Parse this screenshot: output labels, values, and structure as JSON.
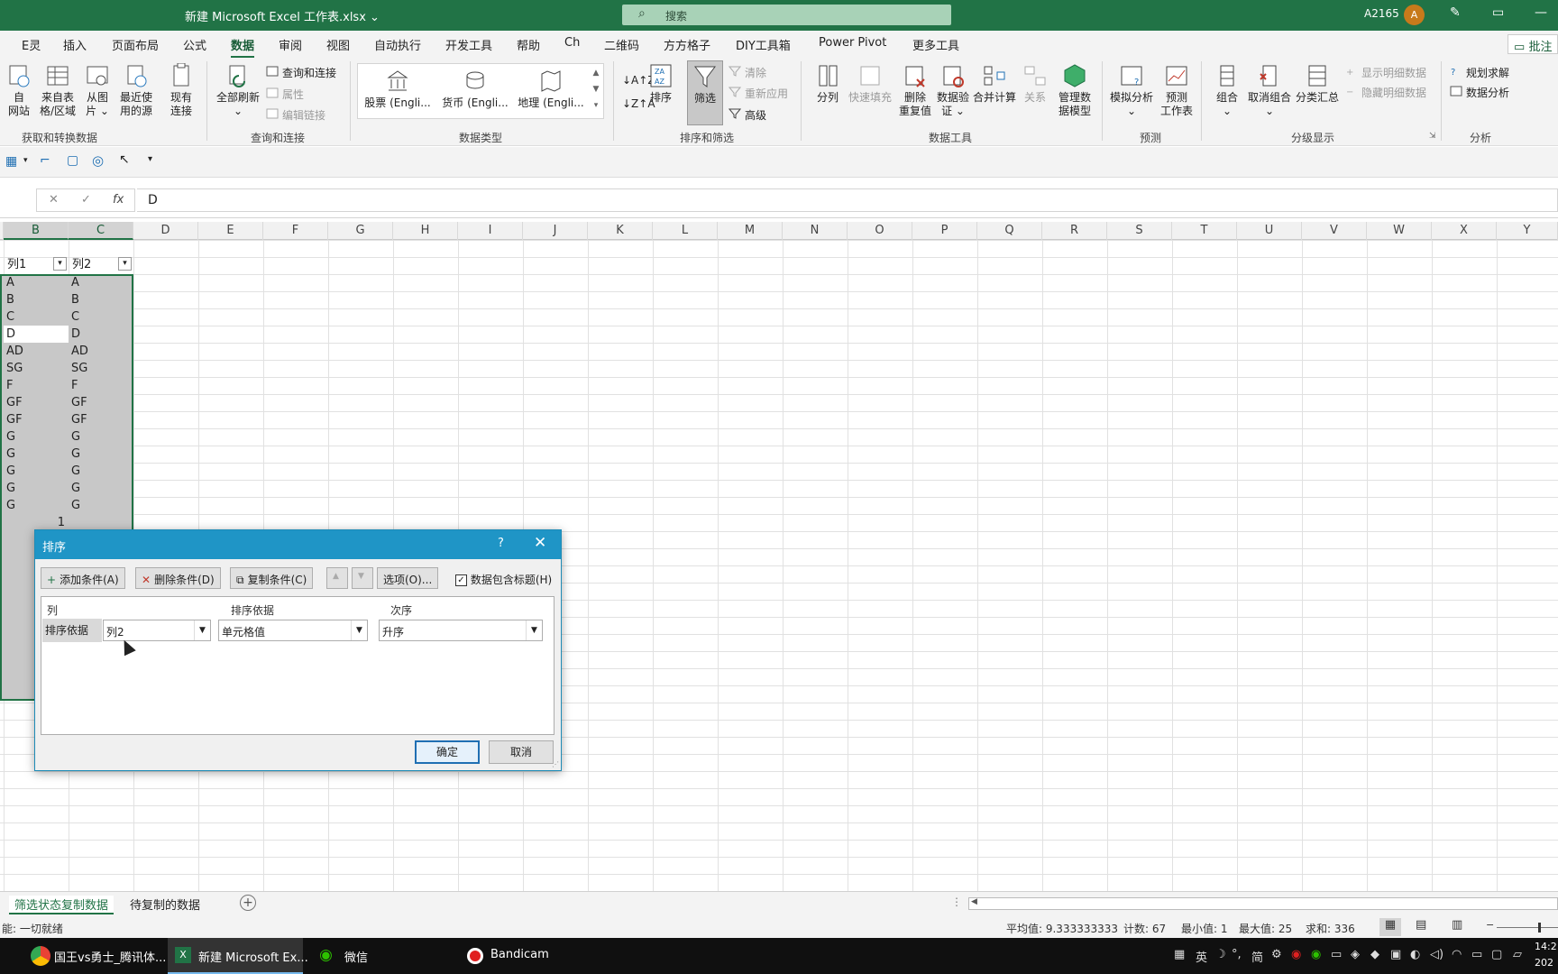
{
  "titlebar": {
    "file_title": "新建 Microsoft Excel 工作表.xlsx ⌄",
    "search_placeholder": "搜索",
    "user_name": "A2165",
    "avatar_initial": "A"
  },
  "tabs": [
    "E灵",
    "插入",
    "页面布局",
    "公式",
    "数据",
    "审阅",
    "视图",
    "自动执行",
    "开发工具",
    "帮助",
    "Ch",
    "二维码",
    "方方格子",
    "DIY工具箱",
    "Power Pivot",
    "更多工具"
  ],
  "active_tab": "数据",
  "comment_label": "批注",
  "ribbon": {
    "get_data": {
      "from_web": "自\n网站",
      "from_table": "来自表\n格/区域",
      "from_picture": "从图\n片 ⌄",
      "recent_sources": "最近使\n用的源",
      "existing_connections": "现有\n连接",
      "group_label": "获取和转换数据"
    },
    "queries": {
      "refresh_all": "全部刷新",
      "queries_connections": "查询和连接",
      "properties": "属性",
      "edit_links": "编辑链接",
      "group_label": "查询和连接"
    },
    "data_types": {
      "stocks": "股票 (Engli...",
      "currency": "货币 (Engli...",
      "geography": "地理 (Engli...",
      "group_label": "数据类型"
    },
    "sort_filter": {
      "sort": "排序",
      "filter": "筛选",
      "clear": "清除",
      "reapply": "重新应用",
      "advanced": "高级",
      "group_label": "排序和筛选"
    },
    "data_tools": {
      "text_to_columns": "分列",
      "flash_fill": "快速填充",
      "remove_duplicates": "删除\n重复值",
      "data_validation": "数据验\n证 ⌄",
      "consolidate": "合并计算",
      "relationships": "关系",
      "manage_model": "管理数\n据模型",
      "group_label": "数据工具"
    },
    "forecast": {
      "what_if": "模拟分析\n⌄",
      "forecast_sheet": "预测\n工作表",
      "group_label": "预测"
    },
    "outline": {
      "group": "组合\n⌄",
      "ungroup": "取消组合\n⌄",
      "subtotal": "分类汇总",
      "show_detail": "显示明细数据",
      "hide_detail": "隐藏明细数据",
      "group_label": "分级显示"
    },
    "analysis": {
      "solver": "规划求解",
      "data_analysis": "数据分析",
      "group_label": "分析"
    }
  },
  "formula_bar": {
    "cancel": "✕",
    "enter": "✓",
    "fx": "fx",
    "content": "D"
  },
  "columns": [
    "B",
    "C",
    "D",
    "E",
    "F",
    "G",
    "H",
    "I",
    "J",
    "K",
    "L",
    "M",
    "N",
    "O",
    "P",
    "Q",
    "R",
    "S",
    "T",
    "U",
    "V",
    "W",
    "X",
    "Y"
  ],
  "table": {
    "headers": [
      "列1",
      "列2"
    ],
    "col1": [
      "A",
      "B",
      "C",
      "D",
      "AD",
      "SG",
      "F",
      "GF",
      "GF",
      "G",
      "G",
      "G",
      "G",
      "G"
    ],
    "col2": [
      "A",
      "B",
      "C",
      "D",
      "AD",
      "SG",
      "F",
      "GF",
      "GF",
      "G",
      "G",
      "G",
      "G",
      "G"
    ],
    "extra_value": "1"
  },
  "dialog": {
    "title": "排序",
    "help": "?",
    "close": "✕",
    "add_condition": "添加条件(A)",
    "delete_condition": "删除条件(D)",
    "copy_condition": "复制条件(C)",
    "move_up": "▲",
    "move_down": "▼",
    "options": "选项(O)...",
    "has_headers": "数据包含标题(H)",
    "col_header_column": "列",
    "col_header_sort_on": "排序依据",
    "col_header_order": "次序",
    "row_label": "排序依据",
    "column_value": "列2",
    "sort_on_value": "单元格值",
    "order_value": "升序",
    "ok": "确定",
    "cancel": "取消"
  },
  "sheet_tabs": [
    "筛选状态复制数据",
    "待复制的数据"
  ],
  "status": {
    "ready": "能: 一切就绪",
    "average": "平均值: 9.333333333",
    "count": "计数: 67",
    "min": "最小值: 1",
    "max": "最大值: 25",
    "sum": "求和: 336"
  },
  "taskbar": {
    "items": [
      "国王vs勇士_腾讯体...",
      "新建 Microsoft Ex...",
      "微信",
      "Bandicam"
    ],
    "ime": "英",
    "ime2": "简",
    "time": "14:2",
    "date": "202"
  },
  "colors": {
    "excel_green": "#217346",
    "dialog_blue": "#1f95c6"
  }
}
